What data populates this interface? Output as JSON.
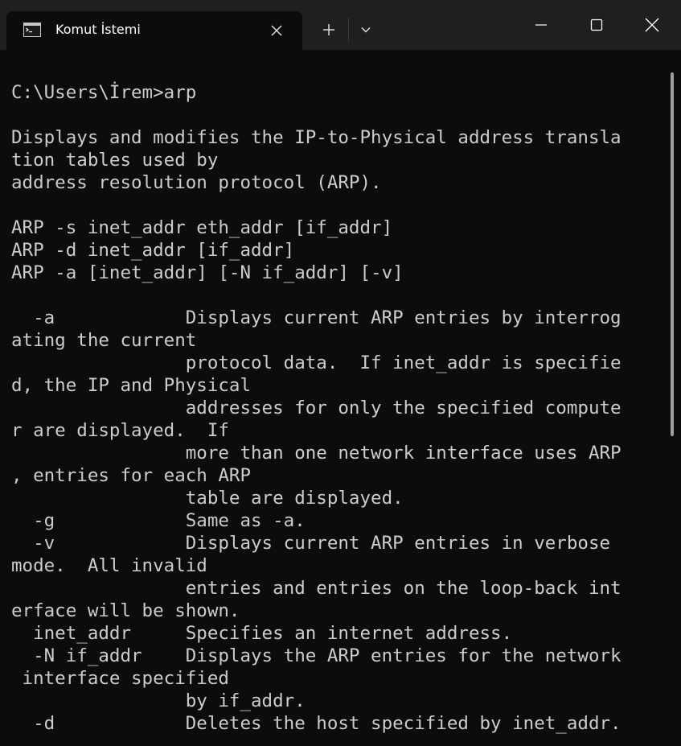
{
  "window": {
    "tab_title": "Komut İstemi",
    "icons": {
      "tab_icon": "cmd-icon",
      "tab_close": "close-icon",
      "new_tab": "plus-icon",
      "dropdown": "chevron-down-icon",
      "minimize": "minimize-icon",
      "maximize": "maximize-icon",
      "close": "close-icon"
    },
    "colors": {
      "titlebar": "#1f1f1f",
      "background": "#0c0c0c",
      "text": "#cccccc"
    }
  },
  "terminal": {
    "lines": [
      "C:\\Users\\İrem>arp",
      "",
      "Displays and modifies the IP-to-Physical address transla",
      "tion tables used by",
      "address resolution protocol (ARP).",
      "",
      "ARP -s inet_addr eth_addr [if_addr]",
      "ARP -d inet_addr [if_addr]",
      "ARP -a [inet_addr] [-N if_addr] [-v]",
      "",
      "  -a            Displays current ARP entries by interrog",
      "ating the current",
      "                protocol data.  If inet_addr is specifie",
      "d, the IP and Physical",
      "                addresses for only the specified compute",
      "r are displayed.  If",
      "                more than one network interface uses ARP",
      ", entries for each ARP",
      "                table are displayed.",
      "  -g            Same as -a.",
      "  -v            Displays current ARP entries in verbose",
      "mode.  All invalid",
      "                entries and entries on the loop-back int",
      "erface will be shown.",
      "  inet_addr     Specifies an internet address.",
      "  -N if_addr    Displays the ARP entries for the network",
      " interface specified",
      "                by if_addr.",
      "  -d            Deletes the host specified by inet_addr."
    ]
  }
}
